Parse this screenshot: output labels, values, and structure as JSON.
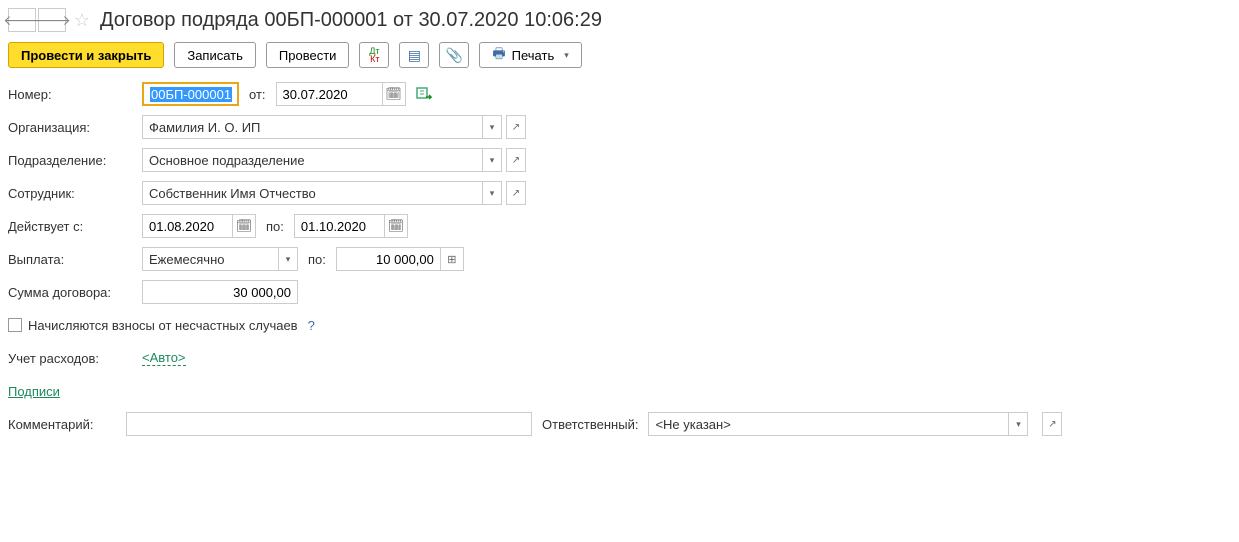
{
  "header": {
    "title": "Договор подряда 00БП-000001 от 30.07.2020 10:06:29"
  },
  "toolbar": {
    "post_and_close": "Провести и закрыть",
    "save": "Записать",
    "post": "Провести",
    "print": "Печать"
  },
  "labels": {
    "number": "Номер:",
    "from": "от:",
    "organization": "Организация:",
    "department": "Подразделение:",
    "employee": "Сотрудник:",
    "valid_from": "Действует с:",
    "to": "по:",
    "payment": "Выплата:",
    "per": "по:",
    "contract_sum": "Сумма договора:",
    "accident_insurance": "Начисляются взносы от несчастных случаев",
    "expense_accounting": "Учет расходов:",
    "signatures": "Подписи",
    "comment": "Комментарий:",
    "responsible": "Ответственный:"
  },
  "values": {
    "number": "00БП-000001",
    "date": "30.07.2020",
    "organization": "Фамилия И. О. ИП",
    "department": "Основное подразделение",
    "employee": "Собственник Имя Отчество",
    "valid_from": "01.08.2020",
    "valid_to": "01.10.2020",
    "payment_type": "Ежемесячно",
    "payment_amount": "10 000,00",
    "contract_sum": "30 000,00",
    "expense_auto": "<Авто>",
    "comment": "",
    "responsible": "<Не указан>"
  }
}
